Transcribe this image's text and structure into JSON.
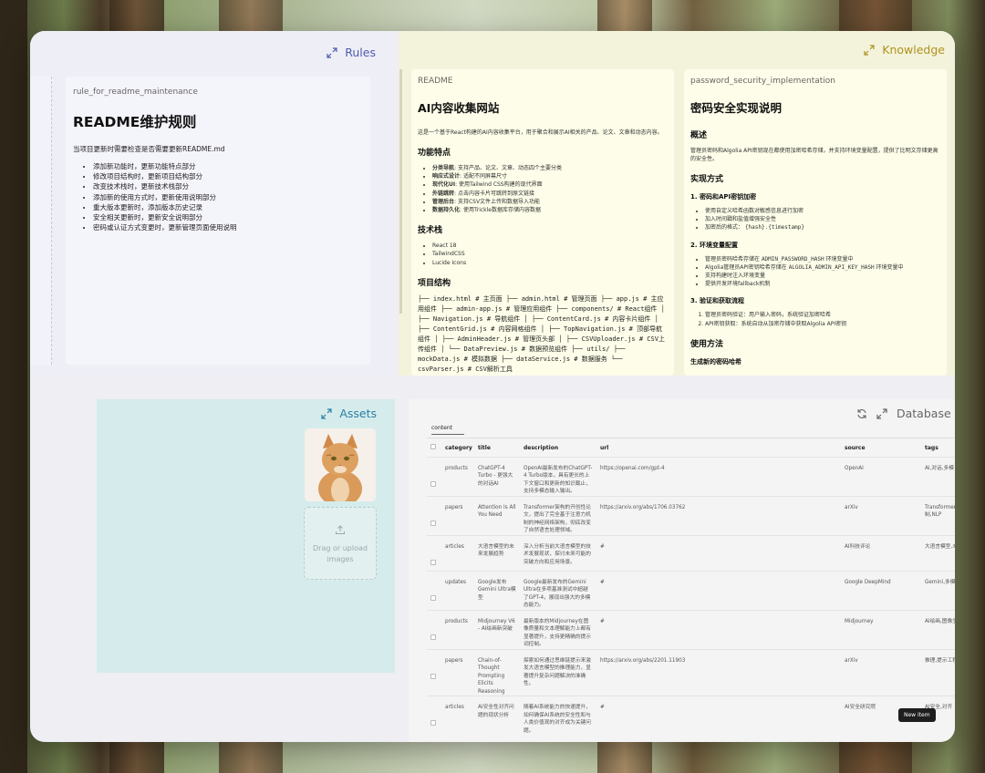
{
  "rules": {
    "title": "Rules",
    "card": {
      "subtitle": "rule_for_readme_maintenance",
      "heading": "README维护规则",
      "intro": "当项目更新时需要检查是否需要更新README.md",
      "items": [
        "添加新功能时，更新功能特点部分",
        "修改项目结构时，更新项目结构部分",
        "改变技术栈时，更新技术栈部分",
        "添加新的使用方式时，更新使用说明部分",
        "重大版本更新时，添加版本历史记录",
        "安全相关更新时，更新安全说明部分",
        "密码或认证方式变更时，更新管理页面使用说明"
      ]
    }
  },
  "knowledge": {
    "title": "Knowledge",
    "readme": {
      "subtitle": "README",
      "heading": "AI内容收集网站",
      "intro": "这是一个基于React构建的AI内容收集平台，用于聚合和展示AI相关的产品、论文、文章和动态内容。",
      "features_title": "功能特点",
      "features": [
        {
          "b": "分类导航",
          "t": ": 支持产品、论文、文章、动态四个主要分类"
        },
        {
          "b": "响应式设计",
          "t": ": 适配不同屏幕尺寸"
        },
        {
          "b": "现代化UI",
          "t": ": 使用Tailwind CSS构建的现代界面"
        },
        {
          "b": "外链跳转",
          "t": ": 点击内容卡片可跳转到原文链接"
        },
        {
          "b": "管理后台",
          "t": ": 支持CSV文件上传和数据导入功能"
        },
        {
          "b": "数据持久化",
          "t": ": 使用Trickle数据库存储内容数据"
        }
      ],
      "stack_title": "技术栈",
      "stack": [
        "React 18",
        "TailwindCSS",
        "Lucide Icons"
      ],
      "structure_title": "项目结构",
      "structure": "├── index.html # 主页面 ├── admin.html # 管理页面 ├── app.js # 主应用组件 ├── admin-app.js # 管理应用组件 ├── components/ # React组件 │ ├── Navigation.js # 导航组件 │ ├── ContentCard.js # 内容卡片组件 │ ├── ContentGrid.js # 内容网格组件 │ ├── TopNavigation.js # 顶部导航组件 │ ├── AdminHeader.js # 管理页头部 │ ├── CSVUploader.js # CSV上传组件 │ └── DataPreview.js # 数据预览组件 ├── utils/ ├── mockData.js # 模拟数据 ├── dataService.js # 数据服务 └── csvParser.js # CSV解析工具"
    },
    "password": {
      "subtitle": "password_security_implementation",
      "heading": "密码安全实现说明",
      "overview_title": "概述",
      "overview": "管理员密码和Algolia API密钥现在都使用加密哈希存储，并支持环境变量配置，提供了比明文存储更高的安全性。",
      "impl_title": "实现方式",
      "s1_title": "1. 密码和API密钥加密",
      "s1": [
        "使用自定义哈希函数对敏感信息进行加密",
        "加入时间戳和盐值增强安全性"
      ],
      "s1_prefix": "加密后的格式：",
      "s1_code": "{hash}.{timestamp}",
      "s2_title": "2. 环境变量配置",
      "s2_a_prefix": "管理员密码哈希存储在",
      "s2_a_code": "ADMIN_PASSWORD_HASH",
      "s2_a_suffix": "环境变量中",
      "s2_b_prefix": "Algolia管理员API密钥哈希存储在",
      "s2_b_code": "ALGOLIA_ADMIN_API_KEY_HASH",
      "s2_b_suffix": "环境变量中",
      "s2_rest": [
        "支持构建时注入环境变量",
        "提供开发环境fallback机制"
      ],
      "s3_title": "3. 验证和获取流程",
      "s3": [
        "管理员密码验证：用户输入密码，系统验证加密哈希",
        "API密钥获取：系统自动从加密存储中获取Algolia API密钥"
      ],
      "usage_title": "使用方法",
      "usage_sub": "生成新的密码哈希"
    }
  },
  "assets": {
    "title": "Assets",
    "upload_line1": "Drag or upload",
    "upload_line2": "images"
  },
  "database": {
    "title": "Database",
    "tab": "content",
    "columns": [
      "category",
      "title",
      "description",
      "url",
      "source",
      "tags"
    ],
    "rows": [
      {
        "category": "products",
        "title": "ChatGPT-4 Turbo - 更强大的对话AI",
        "description": "OpenAI最新发布的ChatGPT-4 Turbo版本，具有更长的上下文窗口和更新的知识截止，支持多模态输入输出。",
        "url": "https://openai.com/gpt-4",
        "source": "OpenAI",
        "tags": "AI,对话,多模"
      },
      {
        "category": "papers",
        "title": "Attention Is All You Need",
        "description": "Transformer架构的开创性论文，提出了完全基于注意力机制的神经网络架构，彻底改变了自然语言处理领域。",
        "url": "https://arxiv.org/abs/1706.03762",
        "source": "arXiv",
        "tags": "Transformer,注意力机制,NLP"
      },
      {
        "category": "articles",
        "title": "大语言模型的未来发展趋势",
        "description": "深入分析当前大语言模型的技术发展现状，探讨未来可能的突破方向和应用场景。",
        "url": "#",
        "source": "AI科技评论",
        "tags": "大语言模型,未来发展"
      },
      {
        "category": "updates",
        "title": "Google发布Gemini Ultra模型",
        "description": "Google最新发布的Gemini Ultra在多项基准测试中超越了GPT-4，展现出强大的多模态能力。",
        "url": "#",
        "source": "Google DeepMind",
        "tags": "Gemini,多模态"
      },
      {
        "category": "products",
        "title": "Midjourney V6 - AI绘画新突破",
        "description": "最新版本的Midjourney在图像质量和文本理解能力上都有显著提升，支持更精确的提示词控制。",
        "url": "#",
        "source": "Midjourney",
        "tags": "AI绘画,图像生成"
      },
      {
        "category": "papers",
        "title": "Chain-of-Thought Prompting Elicits Reasoning",
        "description": "探索如何通过思维链提示来激发大语言模型的推理能力，显著提升复杂问题解决的准确性。",
        "url": "https://arxiv.org/abs/2201.11903",
        "source": "arXiv",
        "tags": "推理,提示工程"
      },
      {
        "category": "articles",
        "title": "AI安全性对齐问题的现状分析",
        "description": "随着AI系统能力的快速提升，如何确保AI系统的安全性和与人类价值观的对齐成为关键问题。",
        "url": "#",
        "source": "AI安全研究院",
        "tags": "AI安全,对齐"
      }
    ],
    "new_item": "New item"
  },
  "colors": {
    "rules_accent": "#4d5bb0",
    "knowledge_accent": "#b0921c",
    "assets_accent": "#2a7fa3",
    "database_accent": "#666666"
  }
}
